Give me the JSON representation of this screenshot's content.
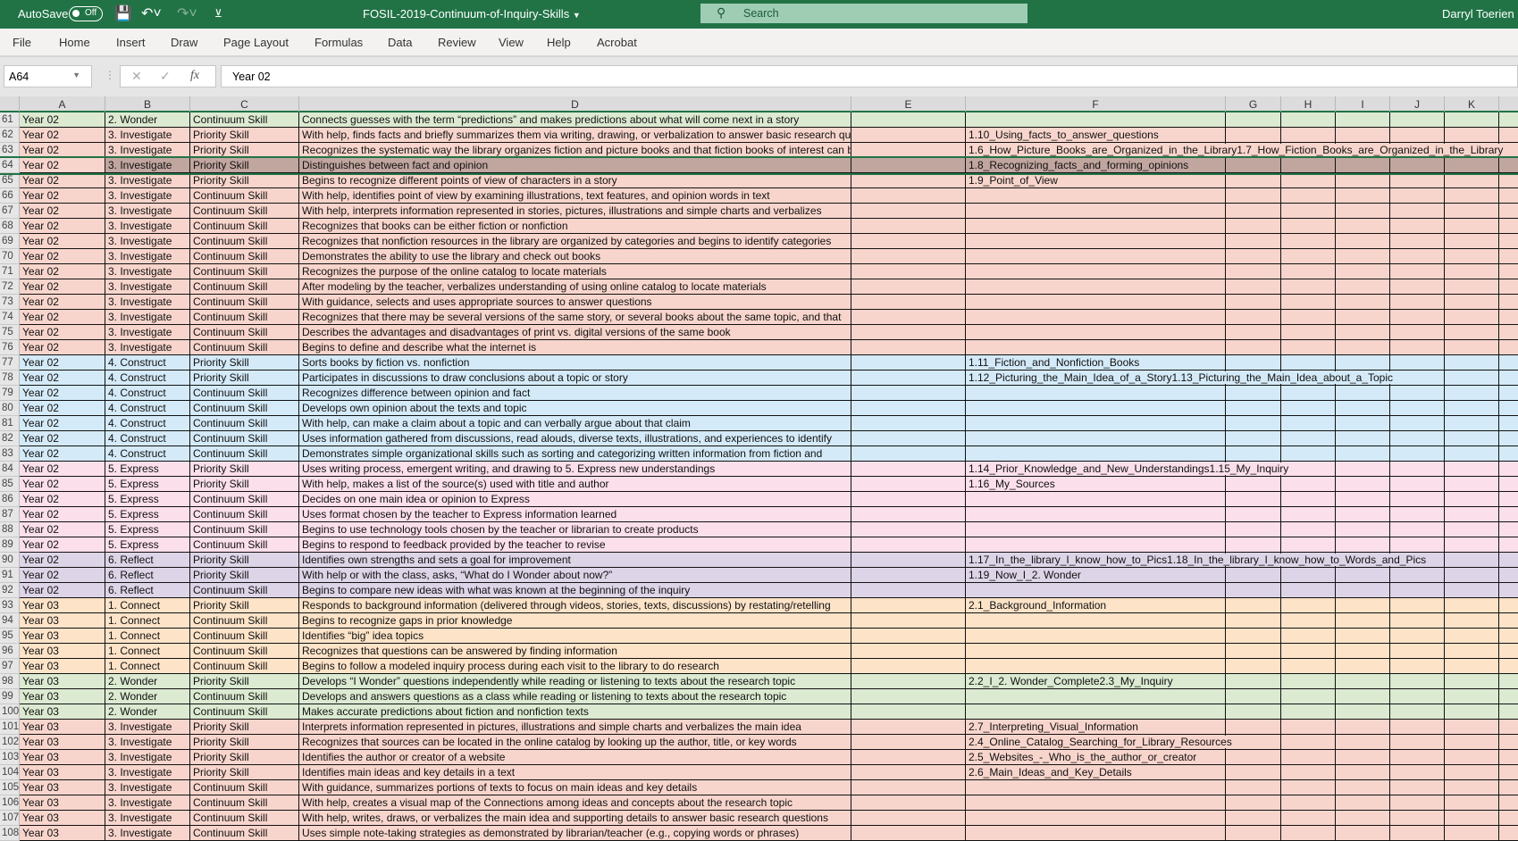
{
  "titlebar": {
    "autosave": "AutoSave",
    "autosave_state": "Off",
    "filename": "FOSIL-2019-Continuum-of-Inquiry-Skills",
    "search_placeholder": "Search",
    "user": "Darryl Toerien"
  },
  "ribbon": {
    "tabs": [
      "File",
      "Home",
      "Insert",
      "Draw",
      "Page Layout",
      "Formulas",
      "Data",
      "Review",
      "View",
      "Help",
      "Acrobat"
    ]
  },
  "formula_bar": {
    "name_box": "A64",
    "value": "Year 02"
  },
  "columns": [
    "A",
    "B",
    "C",
    "D",
    "E",
    "F",
    "G",
    "H",
    "I",
    "J",
    "K"
  ],
  "selected_row": 64,
  "stage_colors": {
    "1. Connect": "#fde3c8",
    "2. Wonder": "#dbead1",
    "3. Investigate": "#f8d5cc",
    "4. Construct": "#d4eaf8",
    "5. Express": "#fbdfeb",
    "6. Reflect": "#ddd4e7"
  },
  "rows": [
    [
      61,
      "Year 02",
      "2. Wonder",
      "Continuum Skill",
      "Connects guesses with the term “predictions” and makes predictions about what will come next in a story",
      ""
    ],
    [
      62,
      "Year 02",
      "3. Investigate",
      "Priority Skill",
      "With help, finds facts and briefly summarizes them via writing, drawing, or verbalization to answer basic research questions",
      "1.10_Using_facts_to_answer_questions"
    ],
    [
      63,
      "Year 02",
      "3. Investigate",
      "Priority Skill",
      "Recognizes the systematic way the library organizes fiction and picture books and that fiction books of interest can be found",
      "1.6_How_Picture_Books_are_Organized_in_the_Library1.7_How_Fiction_Books_are_Organized_in_the_Library"
    ],
    [
      64,
      "Year 02",
      "3. Investigate",
      "Priority Skill",
      "Distinguishes between fact and opinion",
      "1.8_Recognizing_facts_and_forming_opinions"
    ],
    [
      65,
      "Year 02",
      "3. Investigate",
      "Priority Skill",
      "Begins to recognize different points of view of characters in a story",
      "1.9_Point_of_View"
    ],
    [
      66,
      "Year 02",
      "3. Investigate",
      "Continuum Skill",
      "With help, identifies point of view by examining illustrations, text features, and opinion words in text",
      ""
    ],
    [
      67,
      "Year 02",
      "3. Investigate",
      "Continuum Skill",
      "With help, interprets information represented in stories, pictures, illustrations and simple charts and verbalizes",
      ""
    ],
    [
      68,
      "Year 02",
      "3. Investigate",
      "Continuum Skill",
      "Recognizes that books can be either fiction or nonfiction",
      ""
    ],
    [
      69,
      "Year 02",
      "3. Investigate",
      "Continuum Skill",
      "Recognizes that nonfiction resources in the library are organized by categories and begins to identify categories",
      ""
    ],
    [
      70,
      "Year 02",
      "3. Investigate",
      "Continuum Skill",
      "Demonstrates the ability to use the library and check out books",
      ""
    ],
    [
      71,
      "Year 02",
      "3. Investigate",
      "Continuum Skill",
      "Recognizes the purpose of the online catalog to locate materials",
      ""
    ],
    [
      72,
      "Year 02",
      "3. Investigate",
      "Continuum Skill",
      "After modeling by the teacher, verbalizes understanding of using online catalog to locate materials",
      ""
    ],
    [
      73,
      "Year 02",
      "3. Investigate",
      "Continuum Skill",
      "With guidance, selects and uses appropriate sources to answer questions",
      ""
    ],
    [
      74,
      "Year 02",
      "3. Investigate",
      "Continuum Skill",
      "Recognizes that there may be several versions of the same story, or several books about the same topic, and that",
      ""
    ],
    [
      75,
      "Year 02",
      "3. Investigate",
      "Continuum Skill",
      "Describes the advantages and disadvantages of print vs. digital versions of the same book",
      ""
    ],
    [
      76,
      "Year 02",
      "3. Investigate",
      "Continuum Skill",
      "Begins to define and describe what the internet is",
      ""
    ],
    [
      77,
      "Year 02",
      "4. Construct",
      "Priority Skill",
      "Sorts books by fiction vs. nonfiction",
      "1.11_Fiction_and_Nonfiction_Books"
    ],
    [
      78,
      "Year 02",
      "4. Construct",
      "Priority Skill",
      "Participates in discussions to draw conclusions about a topic or story",
      "1.12_Picturing_the_Main_Idea_of_a_Story1.13_Picturing_the_Main_Idea_about_a_Topic"
    ],
    [
      79,
      "Year 02",
      "4. Construct",
      "Continuum Skill",
      "Recognizes difference between opinion and fact",
      ""
    ],
    [
      80,
      "Year 02",
      "4. Construct",
      "Continuum Skill",
      "Develops own opinion about the texts and topic",
      ""
    ],
    [
      81,
      "Year 02",
      "4. Construct",
      "Continuum Skill",
      "With help, can make a claim about a topic and can verbally argue about that claim",
      ""
    ],
    [
      82,
      "Year 02",
      "4. Construct",
      "Continuum Skill",
      "Uses information gathered from discussions, read alouds, diverse texts, illustrations, and experiences to identify",
      ""
    ],
    [
      83,
      "Year 02",
      "4. Construct",
      "Continuum Skill",
      "Demonstrates simple organizational skills such as sorting and categorizing written information from fiction and",
      ""
    ],
    [
      84,
      "Year 02",
      "5. Express",
      "Priority Skill",
      "Uses writing process, emergent writing, and drawing to 5. Express new understandings",
      "1.14_Prior_Knowledge_and_New_Understandings1.15_My_Inquiry"
    ],
    [
      85,
      "Year 02",
      "5. Express",
      "Priority Skill",
      "With help, makes a list of the source(s) used with title and author",
      "1.16_My_Sources"
    ],
    [
      86,
      "Year 02",
      "5. Express",
      "Continuum Skill",
      "Decides on one main idea or opinion to Express",
      ""
    ],
    [
      87,
      "Year 02",
      "5. Express",
      "Continuum Skill",
      "Uses format chosen by the teacher to Express information learned",
      ""
    ],
    [
      88,
      "Year 02",
      "5. Express",
      "Continuum Skill",
      "Begins to use technology tools chosen by the teacher or librarian to create products",
      ""
    ],
    [
      89,
      "Year 02",
      "5. Express",
      "Continuum Skill",
      "Begins to respond to feedback provided by the teacher to revise",
      ""
    ],
    [
      90,
      "Year 02",
      "6. Reflect",
      "Priority Skill",
      "Identifies own strengths and sets a goal for improvement",
      "1.17_In_the_library_I_know_how_to_Pics1.18_In_the_library_I_know_how_to_Words_and_Pics"
    ],
    [
      91,
      "Year 02",
      "6. Reflect",
      "Priority Skill",
      "With help or with the class, asks, “What do I Wonder about now?”",
      "1.19_Now_I_2. Wonder"
    ],
    [
      92,
      "Year 02",
      "6. Reflect",
      "Continuum Skill",
      "Begins to compare new ideas with what was known at the beginning of the inquiry",
      ""
    ],
    [
      93,
      "Year 03",
      "1. Connect",
      "Priority Skill",
      "Responds to background information (delivered through videos, stories, texts, discussions) by restating/retelling",
      "2.1_Background_Information"
    ],
    [
      94,
      "Year 03",
      "1. Connect",
      "Continuum Skill",
      "Begins to recognize gaps in prior knowledge",
      ""
    ],
    [
      95,
      "Year 03",
      "1. Connect",
      "Continuum Skill",
      "Identifies “big” idea topics",
      ""
    ],
    [
      96,
      "Year 03",
      "1. Connect",
      "Continuum Skill",
      "Recognizes that questions can be answered by finding information",
      ""
    ],
    [
      97,
      "Year 03",
      "1. Connect",
      "Continuum Skill",
      "Begins to follow a modeled inquiry process during each visit to the library to do research",
      ""
    ],
    [
      98,
      "Year 03",
      "2. Wonder",
      "Priority Skill",
      "Develops “I Wonder” questions independently while reading or listening to texts about the research topic",
      "2.2_I_2. Wonder_Complete2.3_My_Inquiry"
    ],
    [
      99,
      "Year 03",
      "2. Wonder",
      "Continuum Skill",
      "Develops and answers questions as a class while reading or listening to texts about the research topic",
      ""
    ],
    [
      100,
      "Year 03",
      "2. Wonder",
      "Continuum Skill",
      "Makes accurate predictions about fiction and nonfiction texts",
      ""
    ],
    [
      101,
      "Year 03",
      "3. Investigate",
      "Priority Skill",
      "Interprets information represented in pictures, illustrations and simple charts and verbalizes the main idea",
      "2.7_Interpreting_Visual_Information"
    ],
    [
      102,
      "Year 03",
      "3. Investigate",
      "Priority Skill",
      "Recognizes that sources can be located in the online catalog by looking up the author, title, or key words",
      "2.4_Online_Catalog_Searching_for_Library_Resources"
    ],
    [
      103,
      "Year 03",
      "3. Investigate",
      "Priority Skill",
      "Identifies the author or creator of a website",
      "2.5_Websites_-_Who_is_the_author_or_creator"
    ],
    [
      104,
      "Year 03",
      "3. Investigate",
      "Priority Skill",
      "Identifies main ideas and key details in a text",
      "2.6_Main_Ideas_and_Key_Details"
    ],
    [
      105,
      "Year 03",
      "3. Investigate",
      "Continuum Skill",
      "With guidance, summarizes portions of texts to focus on main ideas and key details",
      ""
    ],
    [
      106,
      "Year 03",
      "3. Investigate",
      "Continuum Skill",
      "With help, creates a visual map of the Connections among ideas and concepts about the research topic",
      ""
    ],
    [
      107,
      "Year 03",
      "3. Investigate",
      "Continuum Skill",
      "With help, writes, draws, or verbalizes the main idea and supporting details to answer basic research questions",
      ""
    ],
    [
      108,
      "Year 03",
      "3. Investigate",
      "Continuum Skill",
      "Uses simple note-taking strategies as demonstrated by librarian/teacher (e.g., copying words or phrases)",
      ""
    ]
  ]
}
